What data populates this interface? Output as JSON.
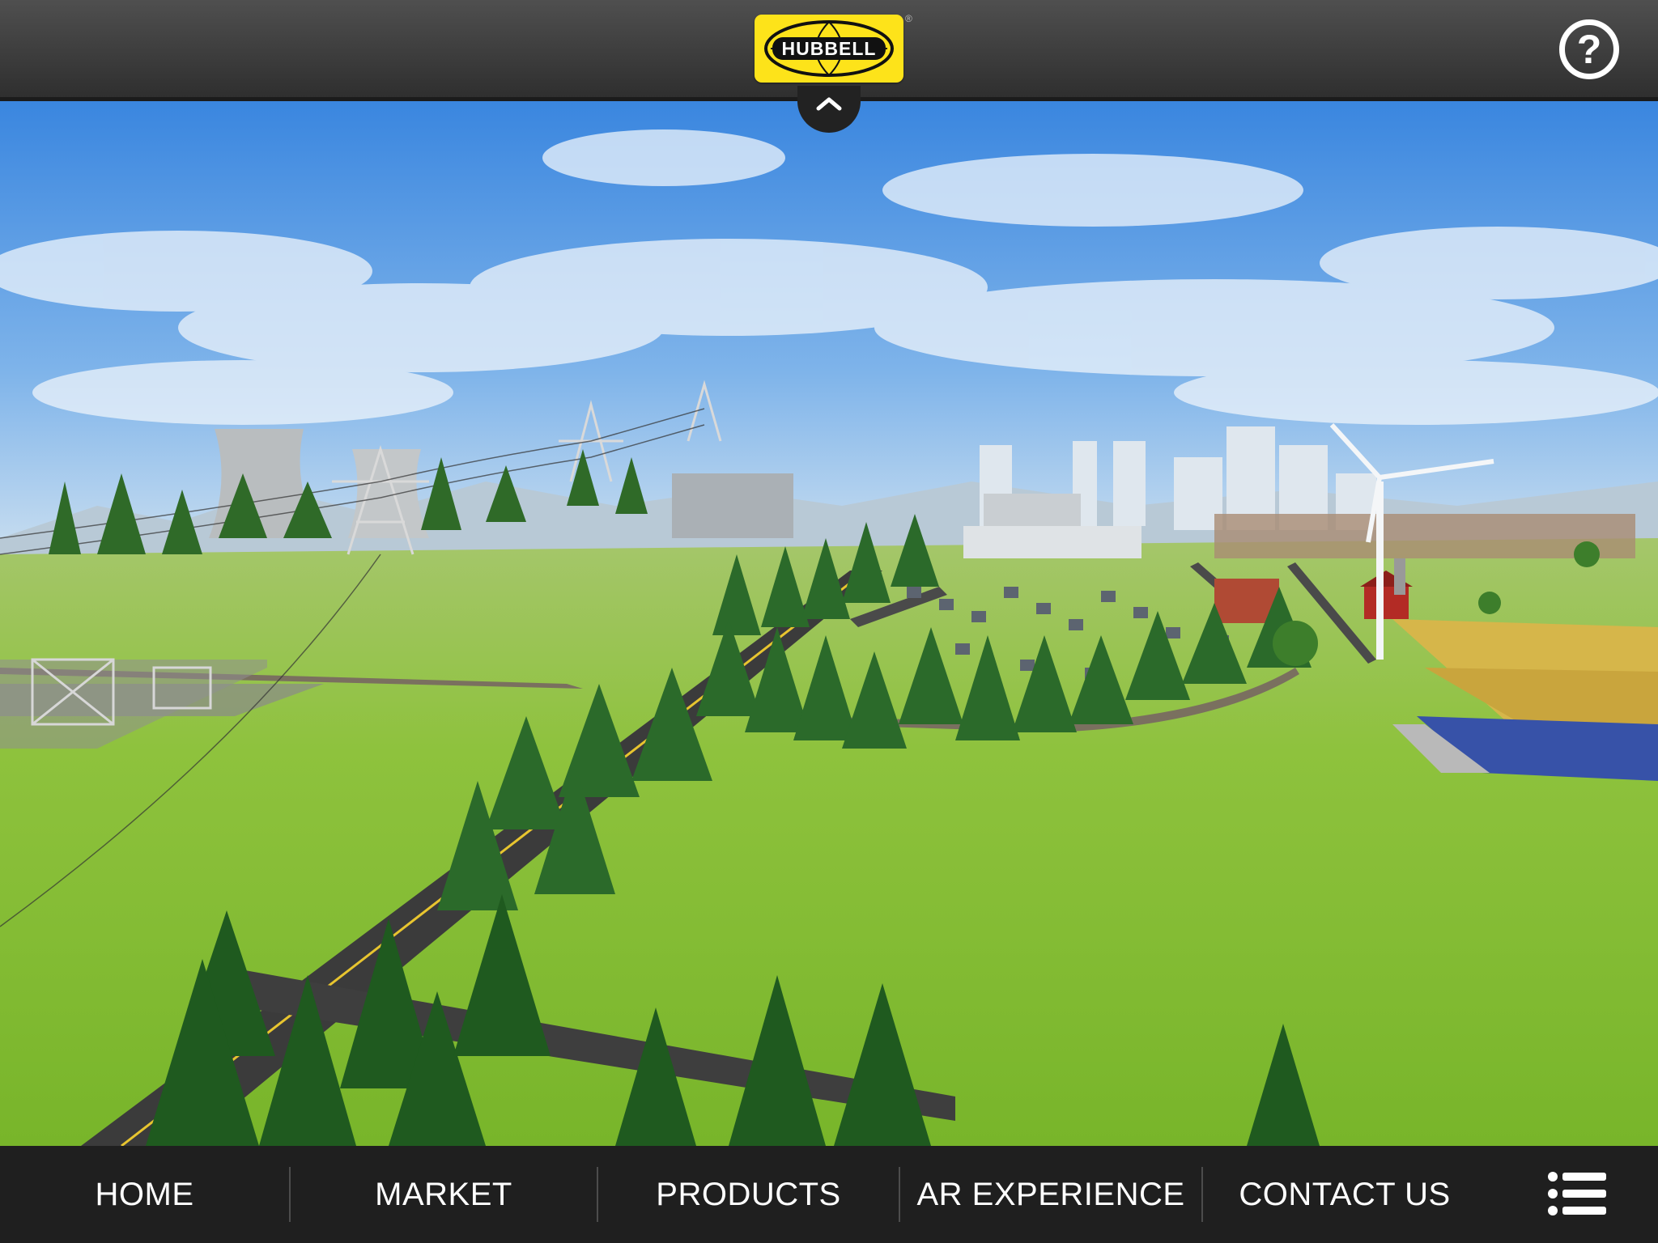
{
  "header": {
    "logo_text": "HUBBELL",
    "help_icon": "question-circle-icon",
    "collapse_icon": "chevron-up-icon"
  },
  "nav": {
    "items": [
      {
        "label": "HOME"
      },
      {
        "label": "MARKET"
      },
      {
        "label": "PRODUCTS"
      },
      {
        "label": "AR EXPERIENCE"
      },
      {
        "label": "CONTACT US"
      }
    ],
    "menu_icon": "hamburger-list-icon"
  },
  "colors": {
    "header_bg": "#3d3d3d",
    "logo_yellow": "#fde31a",
    "nav_bg": "#1f1f1f",
    "grass": "#8cc43a",
    "sky": "#3f8be0"
  }
}
